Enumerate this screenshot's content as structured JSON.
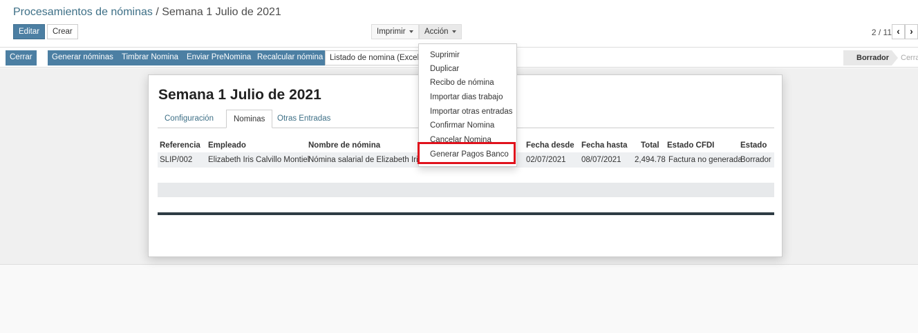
{
  "breadcrumb": {
    "parent": "Procesamientos de nóminas",
    "separator": " / ",
    "current": "Semana 1 Julio de 2021"
  },
  "buttons": {
    "edit": "Editar",
    "create": "Crear",
    "print": "Imprimir",
    "action": "Acción"
  },
  "pager": {
    "value": "2 / 11",
    "prev": "‹",
    "next": "›"
  },
  "statusbar": {
    "buttons": [
      "Cerrar",
      "Generar nóminas",
      "Timbrar Nomina",
      "Enviar PreNomina",
      "Recalcular nómina",
      "Listado de nomina (Excel)"
    ],
    "states": [
      "Borrador",
      "Cerrar"
    ]
  },
  "form": {
    "title": "Semana 1 Julio de 2021",
    "tabs": [
      "Configuración",
      "Nominas",
      "Otras Entradas"
    ],
    "columns": [
      "Referencia",
      "Empleado",
      "Nombre de nómina",
      "Fecha desde",
      "Fecha hasta",
      "Total",
      "Estado CFDI",
      "Estado"
    ],
    "rows": [
      {
        "ref": "SLIP/002",
        "employee": "Elizabeth Iris Calvillo Montiel",
        "name": "Nómina salarial de Elizabeth Iris Calvillo Montiel",
        "from": "02/07/2021",
        "to": "08/07/2021",
        "total": "2,494.78",
        "cfdi": "Factura no generada",
        "state": "Borrador"
      }
    ]
  },
  "action_menu": [
    "Suprimir",
    "Duplicar",
    "Recibo de nómina",
    "Importar dias trabajo",
    "Importar otras entradas",
    "Confirmar Nomina",
    "Cancelar Nomina",
    "Generar Pagos Banco"
  ],
  "colors": {
    "primary": "#4c7fa3",
    "link": "#3d6f86",
    "highlight": "#e0111c"
  }
}
